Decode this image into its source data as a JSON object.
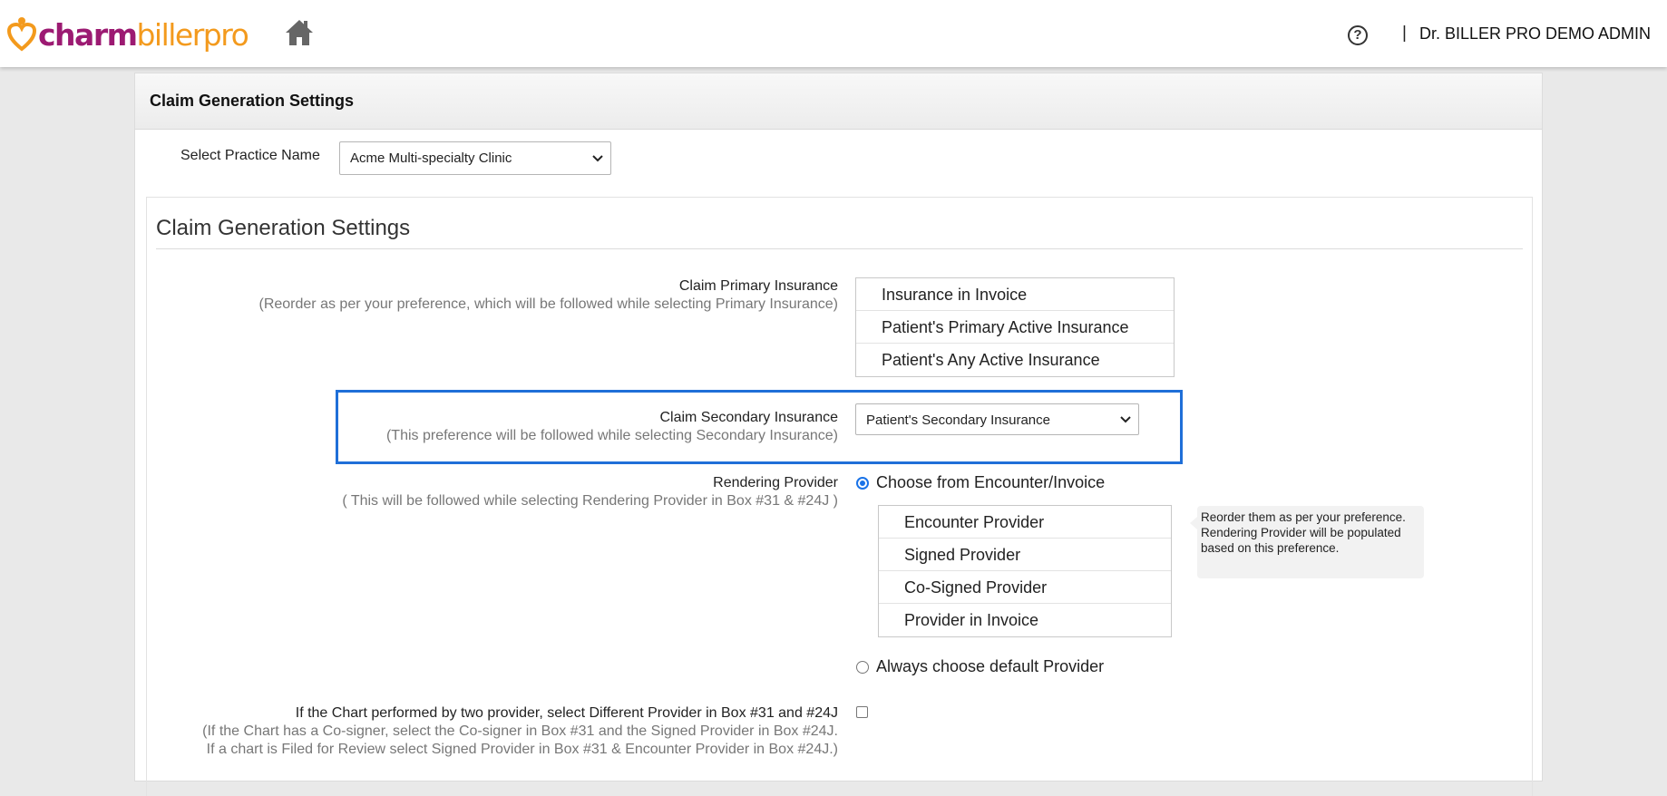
{
  "header": {
    "logo_part1": "charm",
    "logo_part2": "billerpro",
    "help_symbol": "?",
    "separator": "|",
    "user_name": "Dr. BILLER PRO DEMO ADMIN"
  },
  "panel": {
    "title": "Claim Generation Settings",
    "practice_label": "Select Practice Name",
    "practice_value": "Acme Multi-specialty Clinic"
  },
  "settings": {
    "title": "Claim Generation Settings",
    "primary": {
      "label": "Claim Primary Insurance",
      "sub": "(Reorder as per your preference, which will be followed while selecting Primary Insurance)",
      "items": [
        "Insurance in Invoice",
        "Patient's Primary Active Insurance",
        "Patient's Any Active Insurance"
      ]
    },
    "secondary": {
      "label": "Claim Secondary Insurance",
      "sub": "(This preference will be followed while selecting Secondary Insurance)",
      "value": "Patient's Secondary Insurance"
    },
    "rendering": {
      "label": "Rendering Provider",
      "sub": "( This will be followed while selecting Rendering Provider in Box #31 & #24J )",
      "option_encounter": "Choose from Encounter/Invoice",
      "items": [
        "Encounter Provider",
        "Signed Provider",
        "Co-Signed Provider",
        "Provider in Invoice"
      ],
      "tooltip": "Reorder them as per your preference. Rendering Provider will be populated based on this preference.",
      "option_default": "Always choose default Provider"
    },
    "two_provider": {
      "label": "If the Chart performed by two provider, select Different Provider in Box #31 and #24J",
      "sub1": "(If the Chart has a Co-signer, select the Co-signer in Box #31 and the Signed Provider in Box #24J.",
      "sub2": "If a chart is Filed for Review select Signed Provider in Box #31 & Encounter Provider in Box #24J.)"
    }
  },
  "colors": {
    "brand_purple": "#9c1a72",
    "brand_orange": "#f39a1d",
    "highlight_blue": "#1f6fd8"
  },
  "icons": {
    "logo": "heart-logo-icon",
    "home": "home-icon",
    "help": "help-icon",
    "dropdown": "chevron-down-icon"
  }
}
